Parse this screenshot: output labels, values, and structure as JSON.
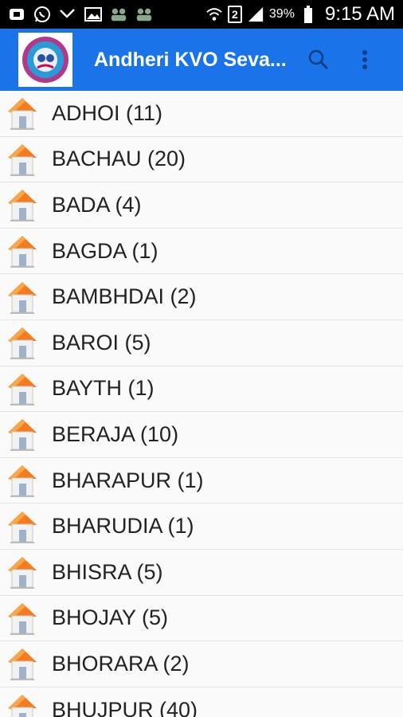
{
  "status_bar": {
    "icons": [
      "notification-icon",
      "whatsapp-icon",
      "missed-call-icon",
      "gallery-icon",
      "app-icon",
      "app-icon",
      "wifi-icon",
      "sim-icon",
      "signal-icon",
      "battery-icon"
    ],
    "sim_label": "2",
    "battery": "39%",
    "time": "9:15 AM"
  },
  "app_bar": {
    "title": "Andheri KVO Seva...",
    "accent": "#1a73e8"
  },
  "villages": [
    "ADHOI (11)",
    "BACHAU (20)",
    "BADA (4)",
    "BAGDA (1)",
    "BAMBHDAI (2)",
    "BAROI (5)",
    "BAYTH (1)",
    "BERAJA (10)",
    "BHARAPUR (1)",
    "BHARUDIA (1)",
    "BHISRA (5)",
    "BHOJAY (5)",
    "BHORARA (2)",
    "BHUJPUR (40)"
  ]
}
